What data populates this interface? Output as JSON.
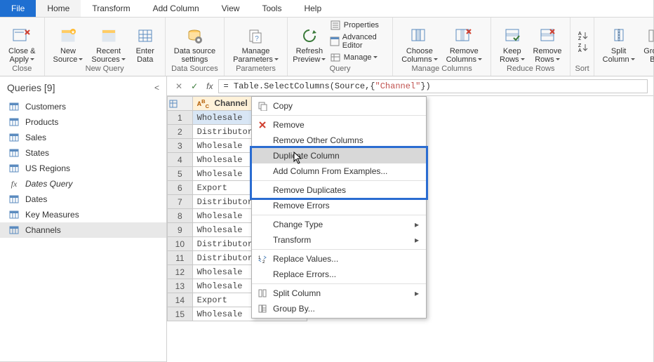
{
  "tabs": {
    "file": "File",
    "home": "Home",
    "transform": "Transform",
    "addcol": "Add Column",
    "view": "View",
    "tools": "Tools",
    "help": "Help"
  },
  "ribbon": {
    "close": {
      "label": "Close &\nApply",
      "group": "Close"
    },
    "new": {
      "label": "New\nSource"
    },
    "recent": {
      "label": "Recent\nSources"
    },
    "enter": {
      "label": "Enter\nData"
    },
    "newq_group": "New Query",
    "dsrc": {
      "label": "Data source\nsettings",
      "group": "Data Sources"
    },
    "param": {
      "label": "Manage\nParameters",
      "group": "Parameters"
    },
    "refresh": {
      "label": "Refresh\nPreview"
    },
    "properties": "Properties",
    "adveditor": "Advanced Editor",
    "manage": "Manage",
    "query_group": "Query",
    "choose": {
      "label": "Choose\nColumns"
    },
    "removec": {
      "label": "Remove\nColumns"
    },
    "managecols_group": "Manage Columns",
    "keep": {
      "label": "Keep\nRows"
    },
    "remover": {
      "label": "Remove\nRows"
    },
    "reduce_group": "Reduce Rows",
    "sort_group": "Sort",
    "split": {
      "label": "Split\nColumn"
    },
    "groupby": {
      "label": "Group\nBy"
    }
  },
  "queries": {
    "title": "Queries [9]",
    "items": [
      {
        "name": "Customers",
        "kind": "table"
      },
      {
        "name": "Products",
        "kind": "table"
      },
      {
        "name": "Sales",
        "kind": "table"
      },
      {
        "name": "States",
        "kind": "table"
      },
      {
        "name": "US Regions",
        "kind": "table"
      },
      {
        "name": "Dates Query",
        "kind": "fx"
      },
      {
        "name": "Dates",
        "kind": "table"
      },
      {
        "name": "Key Measures",
        "kind": "table"
      },
      {
        "name": "Channels",
        "kind": "table",
        "selected": true
      }
    ]
  },
  "formula": {
    "prefix": "= Table.SelectColumns(Source,{",
    "string": "\"Channel\"",
    "suffix": "})"
  },
  "grid": {
    "column_header": "Channel",
    "rows": [
      "Wholesale",
      "Distributor",
      "Wholesale",
      "Wholesale",
      "Wholesale",
      "Export",
      "Distributor",
      "Wholesale",
      "Wholesale",
      "Distributor",
      "Distributor",
      "Wholesale",
      "Wholesale",
      "Export",
      "Wholesale"
    ],
    "selected_row_index": 0
  },
  "context_menu": {
    "items": [
      {
        "label": "Copy",
        "icon": "copy"
      },
      {
        "sep": true
      },
      {
        "label": "Remove",
        "icon": "remove"
      },
      {
        "label": "Remove Other Columns"
      },
      {
        "label": "Duplicate Column",
        "highlight": true
      },
      {
        "label": "Add Column From Examples..."
      },
      {
        "sep": true
      },
      {
        "label": "Remove Duplicates"
      },
      {
        "label": "Remove Errors"
      },
      {
        "sep": true
      },
      {
        "label": "Change Type",
        "submenu": true
      },
      {
        "label": "Transform",
        "submenu": true
      },
      {
        "sep": true
      },
      {
        "label": "Replace Values...",
        "icon": "replace"
      },
      {
        "label": "Replace Errors..."
      },
      {
        "sep": true
      },
      {
        "label": "Split Column",
        "icon": "split",
        "submenu": true
      },
      {
        "label": "Group By...",
        "icon": "group"
      }
    ],
    "highlight_span": [
      3,
      5
    ]
  }
}
